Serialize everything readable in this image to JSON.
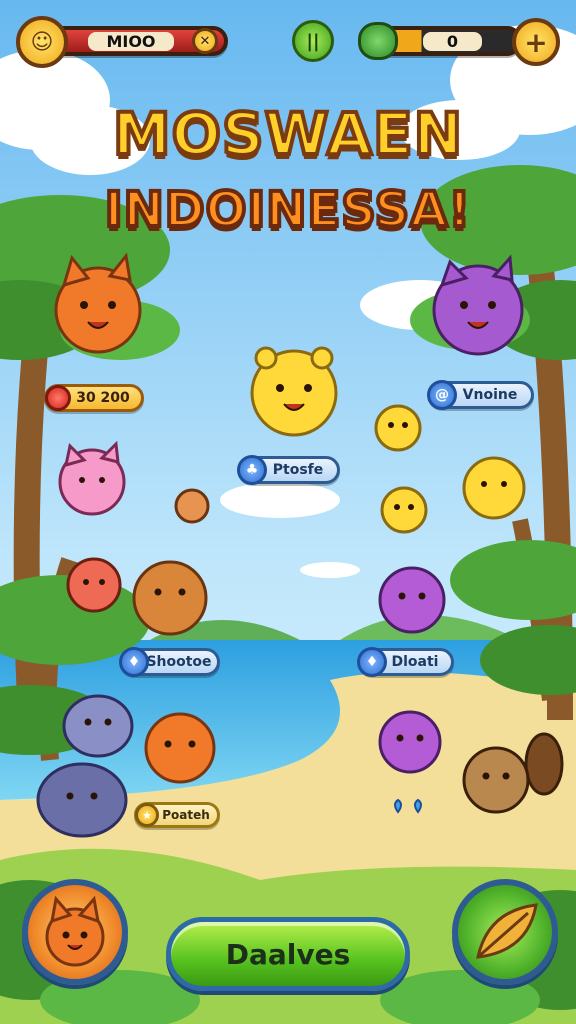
{
  "hud": {
    "left_counter": "MIOO",
    "right_counter": "0",
    "left_counter_icon": "face-icon",
    "center_icon": "pause-icon",
    "right_counter_icon": "green-monster-icon",
    "add_icon": "plus-icon",
    "close_icon": "x-icon"
  },
  "title": {
    "line1": "MOSWAEN",
    "line2": "INDOINESSA!"
  },
  "labels": {
    "orange_score": "30 200",
    "purple_top": "Vnoine",
    "center": "Ptosfe",
    "left_middle": "Shootoe",
    "right_middle": "Dloati",
    "left_bottom": "Poateh"
  },
  "bottom": {
    "main_button": "Daalves",
    "left_button_icon": "orange-fox-icon",
    "right_button_icon": "leaf-icon"
  },
  "colors": {
    "sky_top": "#67b8f0",
    "sea": "#3fb2e6",
    "sand": "#f3df9a",
    "grass": "#9ed14f",
    "title_yellow": "#ffcf2a",
    "title_orange": "#ff8f1f",
    "button_green": "#57c21f"
  }
}
